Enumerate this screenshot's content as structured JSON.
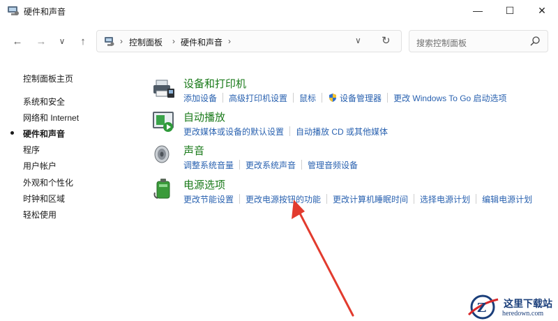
{
  "window": {
    "title": "硬件和声音",
    "minimize_glyph": "—",
    "maximize_glyph": "☐",
    "close_glyph": "✕"
  },
  "nav": {
    "back_glyph": "←",
    "forward_glyph": "→",
    "history_glyph": "∨",
    "up_glyph": "↑",
    "breadcrumb": [
      "控制面板",
      "硬件和声音"
    ],
    "separator": "›",
    "dropdown_glyph": "∨",
    "refresh_glyph": "↻"
  },
  "search": {
    "placeholder": "搜索控制面板"
  },
  "sidebar": {
    "items": [
      {
        "label": "控制面板主页"
      },
      {
        "label": "系统和安全"
      },
      {
        "label": "网络和 Internet"
      },
      {
        "label": "硬件和声音"
      },
      {
        "label": "程序"
      },
      {
        "label": "用户帐户"
      },
      {
        "label": "外观和个性化"
      },
      {
        "label": "时钟和区域"
      },
      {
        "label": "轻松使用"
      }
    ],
    "active_index": 3
  },
  "categories": [
    {
      "title": "设备和打印机",
      "icon": "printer-icon",
      "links": [
        "添加设备",
        "高级打印机设置",
        "鼠标",
        "设备管理器",
        "更改 Windows To Go 启动选项"
      ]
    },
    {
      "title": "自动播放",
      "icon": "autoplay-icon",
      "links": [
        "更改媒体或设备的默认设置",
        "自动播放 CD 或其他媒体"
      ]
    },
    {
      "title": "声音",
      "icon": "speaker-icon",
      "links": [
        "调整系统音量",
        "更改系统声音",
        "管理音频设备"
      ]
    },
    {
      "title": "电源选项",
      "icon": "battery-icon",
      "links": [
        "更改节能设置",
        "更改电源按钮的功能",
        "更改计算机睡眠时间",
        "选择电源计划",
        "编辑电源计划"
      ]
    }
  ],
  "watermark": {
    "name": "这里下载站",
    "url": "heredown.com"
  },
  "colors": {
    "title_green": "#1a7a1a",
    "link_blue": "#2a62b0",
    "arrow_red": "#e23b2e"
  }
}
